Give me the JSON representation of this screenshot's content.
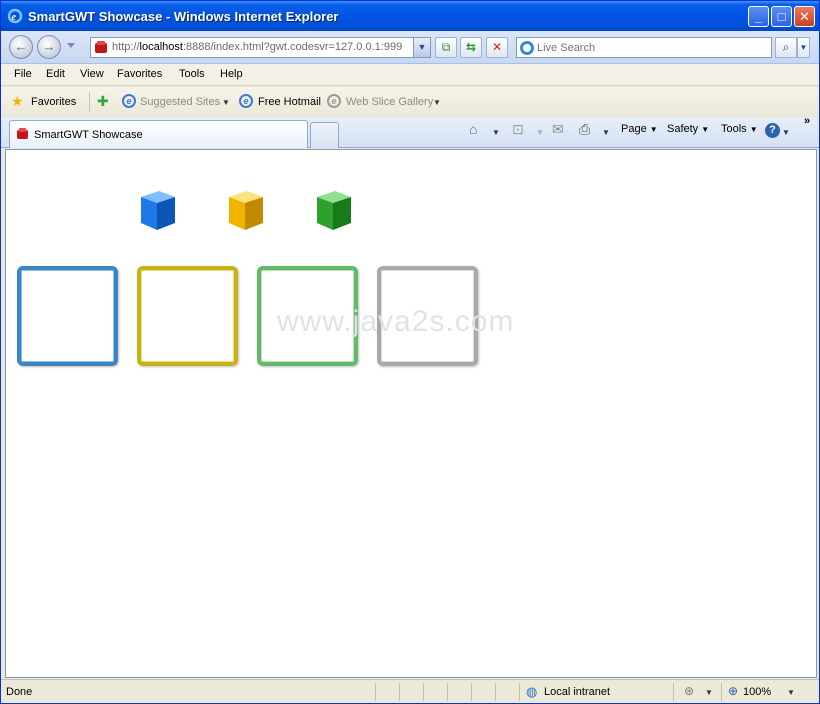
{
  "window": {
    "title": "SmartGWT Showcase - Windows Internet Explorer",
    "minimize": "_",
    "maximize": "□",
    "close": "✕"
  },
  "address_bar": {
    "url_prefix": "http://",
    "url_host": "localhost",
    "url_rest": ":8888/index.html?gwt.codesvr=127.0.0.1:999",
    "search_placeholder": "Live Search"
  },
  "menu": {
    "items": [
      "File",
      "Edit",
      "View",
      "Favorites",
      "Tools",
      "Help"
    ]
  },
  "favorites_bar": {
    "favorites_label": "Favorites",
    "suggested_sites": "Suggested Sites",
    "free_hotmail": "Free Hotmail",
    "web_slice_gallery": "Web Slice Gallery"
  },
  "tabs": {
    "active_tab_label": "SmartGWT Showcase"
  },
  "command_bar": {
    "page": "Page",
    "safety": "Safety",
    "tools": "Tools",
    "overflow": "»"
  },
  "content": {
    "cubes": [
      {
        "color": "#1e78e6",
        "name": "blue-cube"
      },
      {
        "color": "#f0b400",
        "name": "yellow-cube"
      },
      {
        "color": "#2ea02e",
        "name": "green-cube"
      }
    ],
    "frames": [
      {
        "color": "#3a86c4",
        "name": "blue-drop-frame"
      },
      {
        "color": "#c8b21a",
        "name": "yellow-drop-frame"
      },
      {
        "color": "#63b86b",
        "name": "green-drop-frame"
      },
      {
        "color": "#a9a9a9",
        "name": "gray-drop-frame"
      }
    ],
    "watermark": "www.java2s.com"
  },
  "status_bar": {
    "status": "Done",
    "zone": "Local intranet",
    "zoom": "100%"
  }
}
